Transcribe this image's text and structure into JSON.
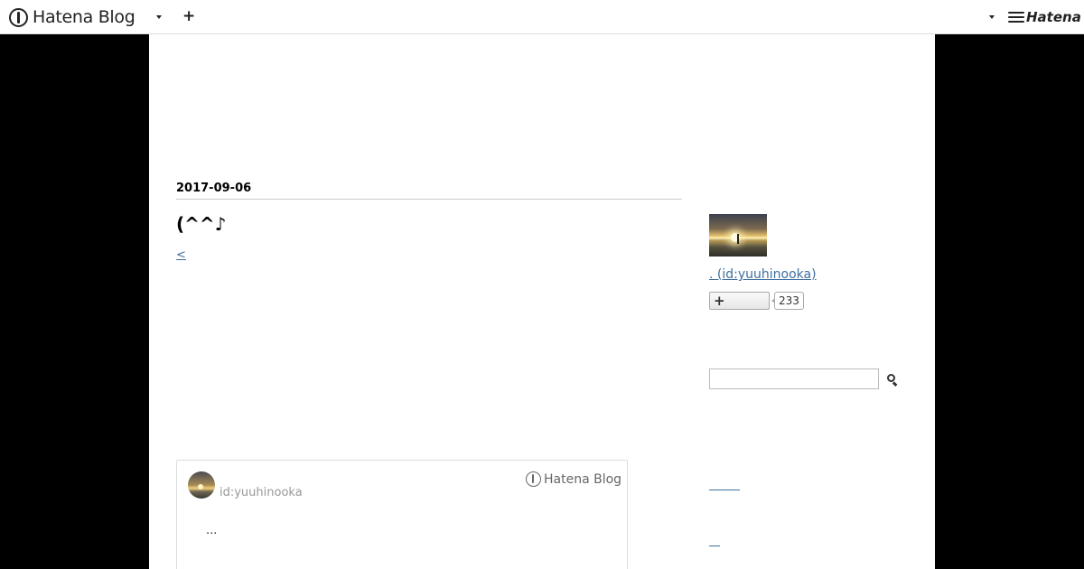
{
  "topbar": {
    "brand": "Hatena Blog",
    "add_label": "+",
    "right_brand": "Hatena"
  },
  "entry": {
    "date": "2017-09-06",
    "title": "(^^♪",
    "back_link": "<"
  },
  "embed_card": {
    "user_id": "id:yuuhinooka",
    "brand": "Hatena Blog",
    "excerpt": "..."
  },
  "sidebar": {
    "profile_link": ". (id:yuuhinooka)",
    "follow_label": "+",
    "follower_count": "233",
    "search_placeholder": ""
  },
  "colors": {
    "link": "#3d6e9f",
    "background": "#000000",
    "content": "#ffffff"
  },
  "icons": [
    "hatena-blog-logo-icon",
    "chevron-down-icon",
    "plus-icon",
    "hatena-logo-icon",
    "search-icon"
  ]
}
